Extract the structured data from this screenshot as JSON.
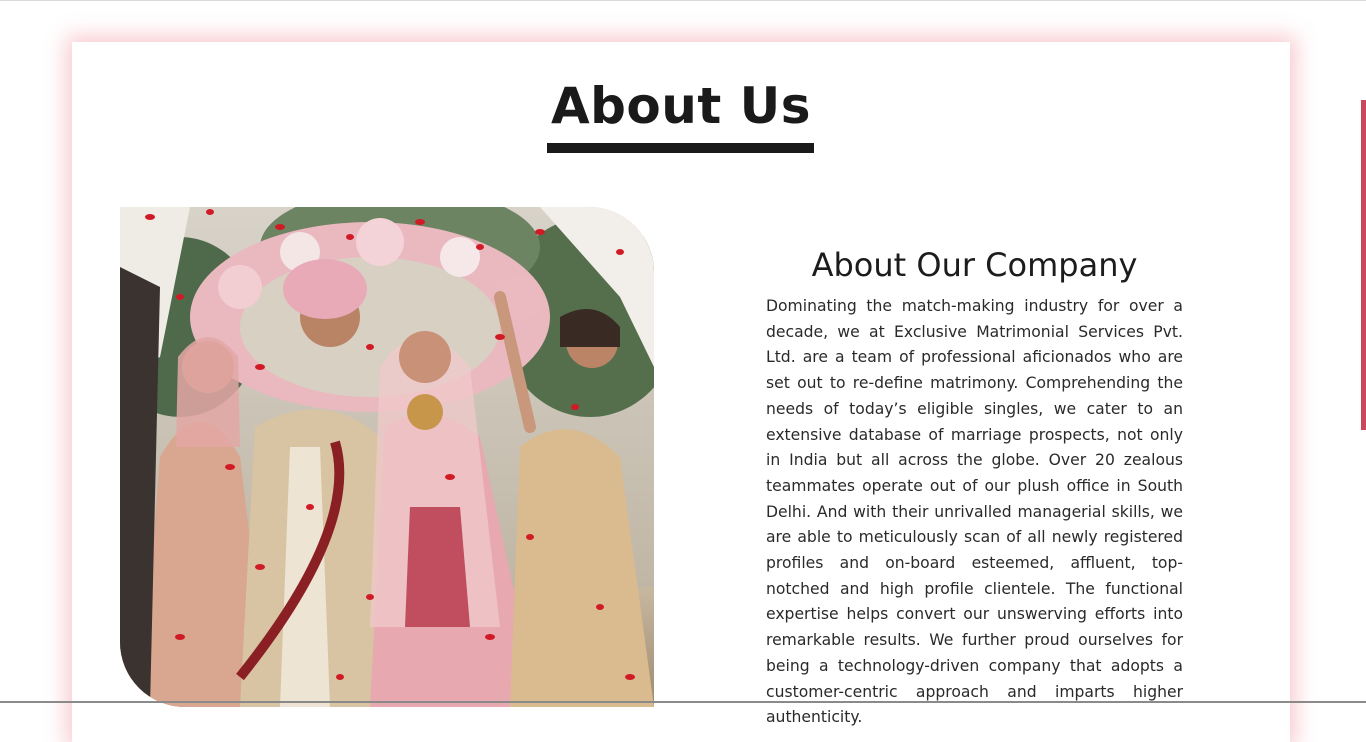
{
  "page": {
    "title": "About Us"
  },
  "company": {
    "heading": "About Our Company",
    "paragraph": "Dominating the match-making industry for over a decade, we at Exclusive Matrimonial Services Pvt. Ltd. are a team of professional aficionados who are set out to re-define matrimony. Comprehending the needs of today’s eligible singles, we cater to an extensive database of marriage prospects, not only in India but all across the globe. Over 20 zealous teammates operate out of our plush office in South Delhi. And with their unrivalled managerial skills, we are able to meticulously scan of all newly registered profiles and on-board esteemed, affluent, top-notched and high profile clientele. The functional expertise helps convert our unswerving efforts into remarkable results. We further proud ourselves for being a technology-driven company that adopts a customer-centric approach and imparts higher authenticity."
  },
  "colors": {
    "accent_glow": "#f08c96",
    "scroll_indicator": "#c9485b",
    "heading_text": "#1a1a1a"
  }
}
